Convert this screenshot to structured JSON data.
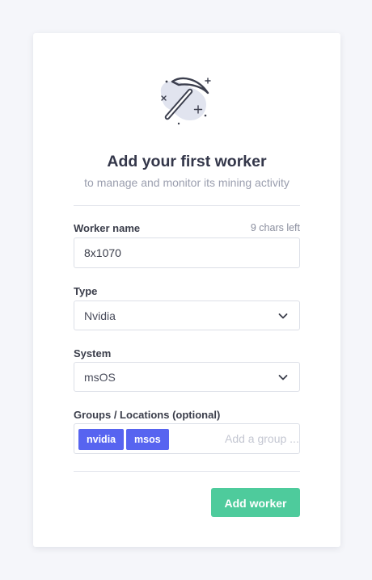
{
  "header": {
    "icon": "pickaxe-icon",
    "title": "Add your first worker",
    "subtitle": "to manage and monitor its mining activity"
  },
  "worker_name": {
    "label": "Worker name",
    "hint": "9 chars left",
    "value": "8x1070"
  },
  "type": {
    "label": "Type",
    "value": "Nvidia"
  },
  "system": {
    "label": "System",
    "value": "msOS"
  },
  "groups": {
    "label": "Groups / Locations (optional)",
    "tags": [
      "nvidia",
      "msos"
    ],
    "placeholder": "Add a group ..."
  },
  "actions": {
    "submit_label": "Add worker"
  },
  "colors": {
    "background": "#f5f6fa",
    "tag": "#5764f0",
    "button": "#4ecb9c"
  }
}
